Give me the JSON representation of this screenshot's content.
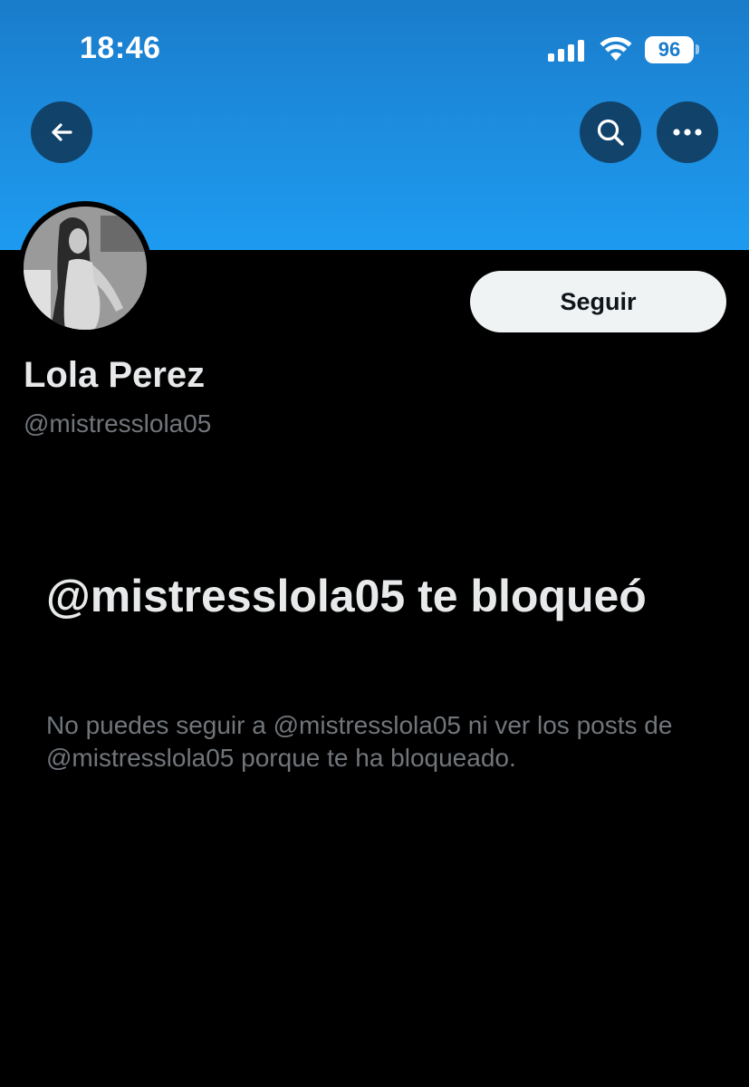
{
  "status_bar": {
    "time": "18:46",
    "battery": "96"
  },
  "header": {
    "banner_color": "#1d9bf0",
    "back_icon": "arrow-left-icon",
    "search_icon": "search-icon",
    "more_icon": "more-horizontal-icon"
  },
  "profile": {
    "display_name": "Lola Perez",
    "handle": "@mistresslola05",
    "follow_label": "Seguir"
  },
  "blocked": {
    "title": "@mistresslola05 te bloqueó",
    "description": "No puedes seguir a @mistresslola05 ni ver los posts de @mistresslola05 porque te ha bloqueado."
  }
}
